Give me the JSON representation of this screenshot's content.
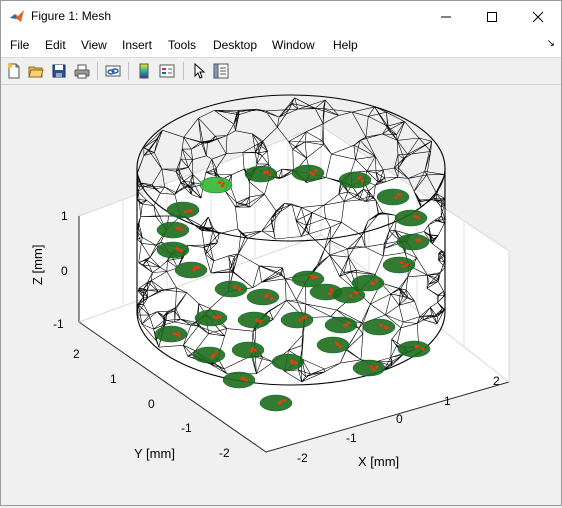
{
  "window": {
    "title": "Figure 1: Mesh"
  },
  "menu": {
    "items": [
      "File",
      "Edit",
      "View",
      "Insert",
      "Tools",
      "Desktop",
      "Window",
      "Help"
    ]
  },
  "toolbar": {
    "icons": [
      "new-figure-icon",
      "open-file-icon",
      "save-icon",
      "print-icon",
      "link-plot-icon",
      "colorbar-icon",
      "legend-icon",
      "pointer-icon",
      "property-editor-icon"
    ]
  },
  "axes": {
    "xlabel": "X [mm]",
    "ylabel": "Y [mm]",
    "zlabel": "Z [mm]",
    "xticks": [
      "-2",
      "-1",
      "0",
      "1",
      "2"
    ],
    "yticks": [
      "-2",
      "-1",
      "0",
      "1",
      "2"
    ],
    "zticks": [
      "-1",
      "0",
      "1"
    ]
  },
  "colors": {
    "mesh": "#000000",
    "patch": "#1d6b1d",
    "patch_highlight": "#33b833",
    "marker": "#e04010"
  }
}
